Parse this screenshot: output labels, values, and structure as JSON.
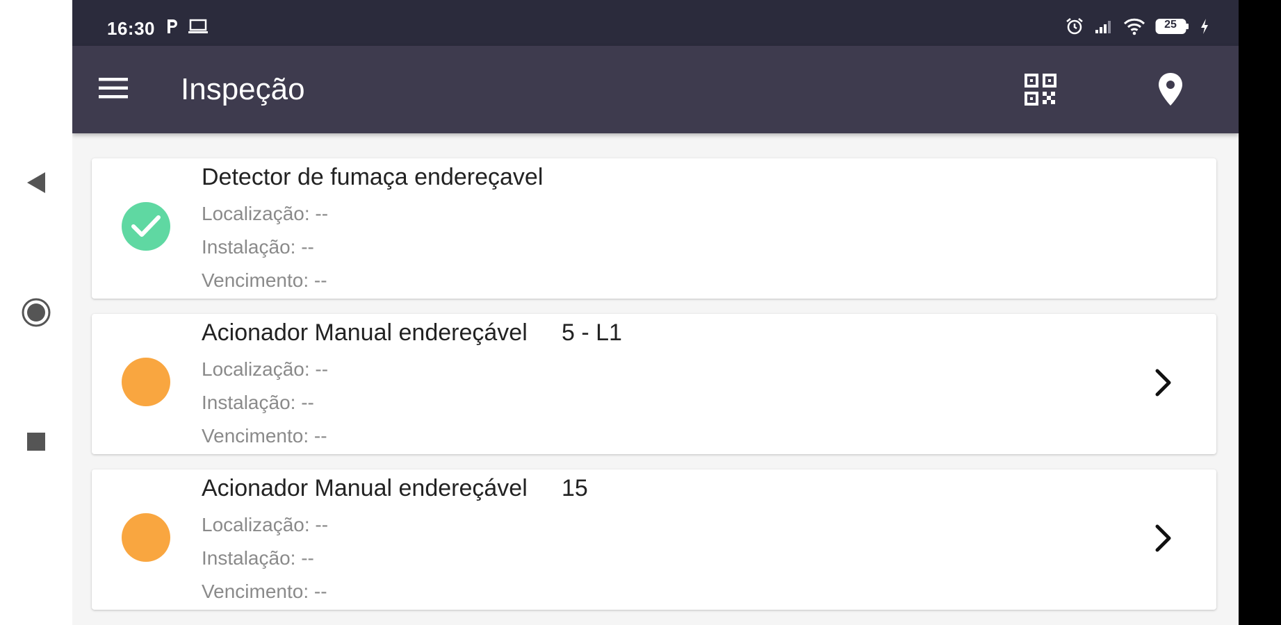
{
  "status_bar": {
    "time": "16:30",
    "left_icons": [
      "parking-p-icon",
      "laptop-icon"
    ],
    "right_icons": [
      "alarm-icon",
      "signal-icon",
      "wifi-icon",
      "battery-icon",
      "charging-icon"
    ],
    "battery_level": "25"
  },
  "app_bar": {
    "title": "Inspeção",
    "icons": [
      "menu-icon",
      "qr-code-icon",
      "location-pin-icon"
    ]
  },
  "colors": {
    "done": "#5fd8a2",
    "pending": "#f9a640",
    "appbar": "#3e3b4e",
    "statusbar": "#2b2b3c"
  },
  "items": [
    {
      "status": "done",
      "title": "Detector de fumaça endereçavel",
      "code": "",
      "localizacao": "Localização: --",
      "instalacao": "Instalação: --",
      "vencimento": "Vencimento: --",
      "has_chevron": false
    },
    {
      "status": "pending",
      "title": "Acionador Manual endereçável",
      "code": "5 - L1",
      "localizacao": "Localização: --",
      "instalacao": "Instalação: --",
      "vencimento": "Vencimento: --",
      "has_chevron": true
    },
    {
      "status": "pending",
      "title": "Acionador Manual endereçável",
      "code": "15",
      "localizacao": "Localização: --",
      "instalacao": "Instalação: --",
      "vencimento": "Vencimento: --",
      "has_chevron": true
    }
  ],
  "system_nav": [
    "back-icon",
    "home-icon",
    "recents-icon"
  ]
}
